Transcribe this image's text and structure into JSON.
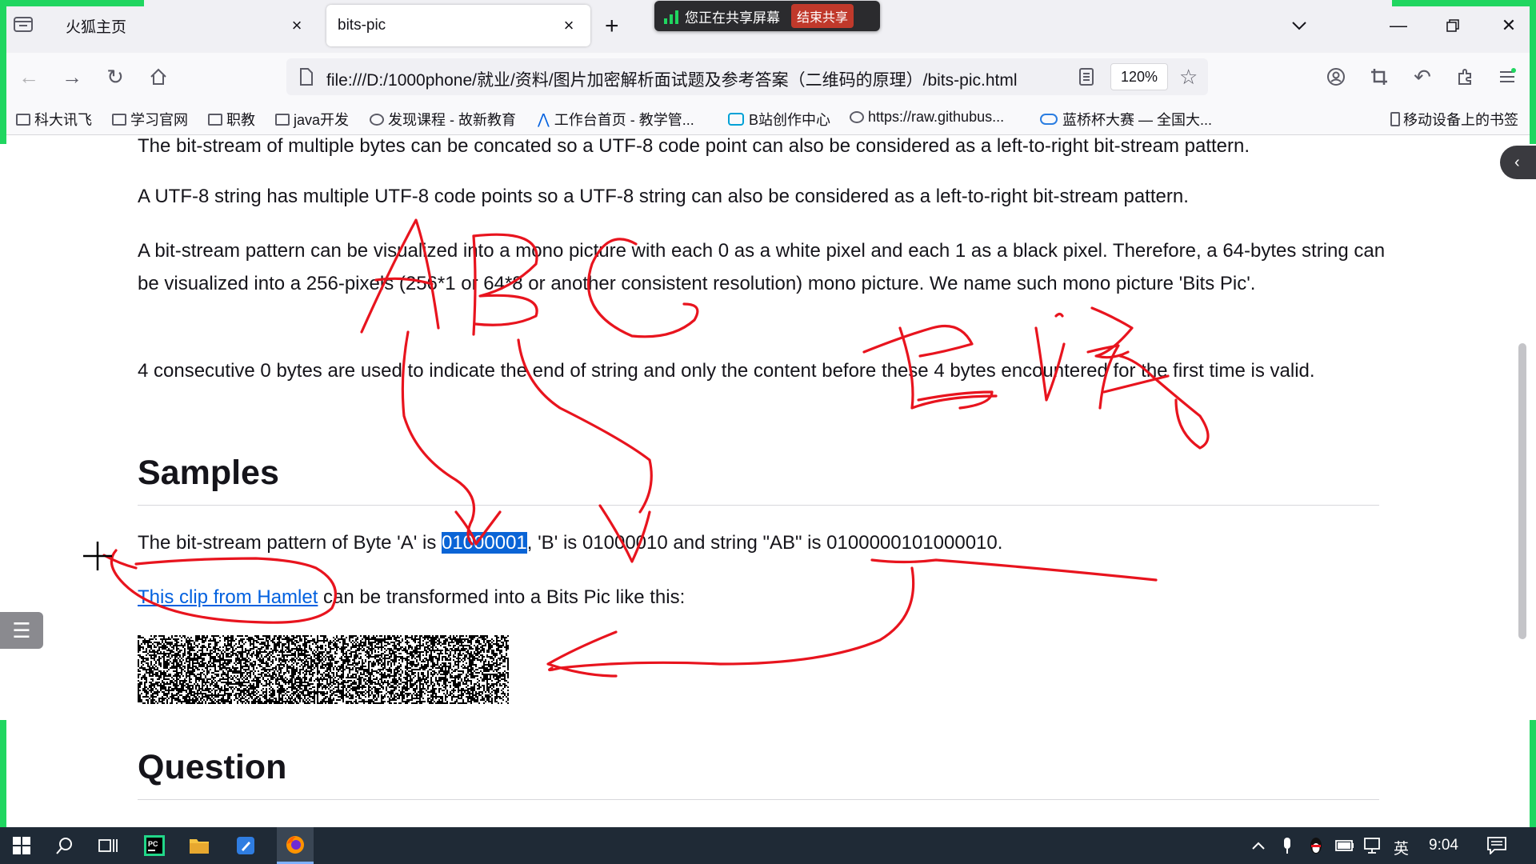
{
  "browser": {
    "tabs": [
      {
        "title": "火狐主页",
        "active": false
      },
      {
        "title": "bits-pic",
        "active": true
      }
    ],
    "new_tab_symbol": "+",
    "share_banner": {
      "text": "您正在共享屏幕",
      "stop_label": "结束共享"
    },
    "url": "file:///D:/1000phone/就业/资料/图片加密解析面试题及参考答案（二维码的原理）/bits-pic.html",
    "zoom": "120%",
    "bookmarks": [
      {
        "label": "科大讯飞",
        "icon": "folder-icon"
      },
      {
        "label": "学习官网",
        "icon": "folder-icon"
      },
      {
        "label": "职教",
        "icon": "folder-icon"
      },
      {
        "label": "java开发",
        "icon": "folder-icon"
      },
      {
        "label": "发现课程 - 故新教育",
        "icon": "globe-icon"
      },
      {
        "label": "工作台首页 - 教学管...",
        "icon": "app-icon"
      },
      {
        "label": "B站创作中心",
        "icon": "bilibili-icon"
      },
      {
        "label": "https://raw.githubus...",
        "icon": "globe-icon"
      },
      {
        "label": "蓝桥杯大赛 — 全国大...",
        "icon": "lanqiao-icon"
      }
    ],
    "mobile_bookmarks": "移动设备上的书签"
  },
  "article": {
    "p1": "The bit-stream of multiple bytes can be concated so a UTF-8 code point can also be considered as a left-to-right bit-stream pattern.",
    "p2": "A UTF-8 string has multiple UTF-8 code points so a UTF-8 string can also be considered as a left-to-right bit-stream pattern.",
    "p3": "A bit-stream pattern can be visualized into a mono picture with each 0 as a white pixel and each 1 as a black pixel. Therefore, a 64-bytes string can be visualized into a 256-pixels (256*1 or 64*8 or another consistent resolution) mono picture. We name such mono picture 'Bits Pic'.",
    "p4": "4 consecutive 0 bytes are used to indicate the end of string and only the content before these 4 bytes encountered for the first time is valid.",
    "samples_heading": "Samples",
    "sample_pre": "The bit-stream pattern of Byte 'A' is ",
    "sample_selected": "01000001",
    "sample_post": ", 'B' is 01000010 and string \"AB\" is 0100000101000010.",
    "clip_link": "This clip from Hamlet",
    "clip_post": " can be transformed into a Bits Pic like this:",
    "question_heading": "Question"
  },
  "taskbar": {
    "ime": "英",
    "time": "9:04"
  },
  "colors": {
    "share_green": "#20d660",
    "annotation_red": "#e8141e",
    "selection_blue": "#0a64d6",
    "link_blue": "#0060df"
  }
}
